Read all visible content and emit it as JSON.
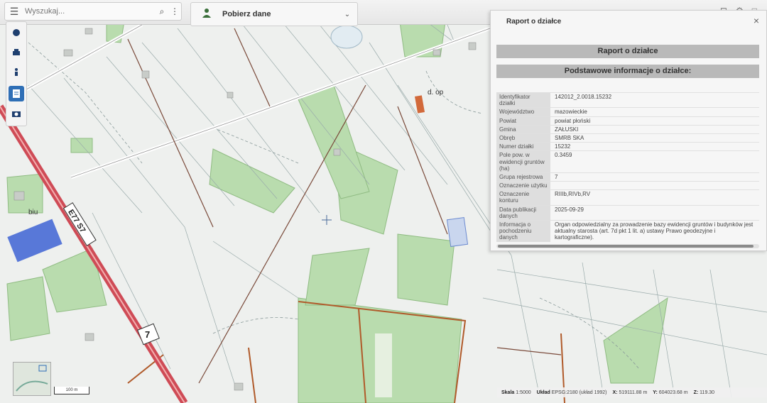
{
  "search": {
    "placeholder": "Wyszukaj..."
  },
  "download": {
    "label": "Pobierz dane"
  },
  "toolbar": {
    "items": [
      {
        "icon": "layers-icon"
      },
      {
        "icon": "print-icon"
      },
      {
        "icon": "street-view-icon"
      },
      {
        "icon": "report-icon"
      },
      {
        "icon": "camera-icon"
      }
    ]
  },
  "map_labels": {
    "road": "E77 S7",
    "route_number": "7",
    "building_label": "biu",
    "field_label": "d. op"
  },
  "panel": {
    "title": "Raport o działce",
    "header_report": "Raport o działce",
    "header_basic": "Podstawowe informacje o działce:",
    "rows": [
      {
        "key": "Identyfikator działki",
        "value": "142012_2.0018.15232"
      },
      {
        "key": "Województwo",
        "value": "mazowieckie"
      },
      {
        "key": "Powiat",
        "value": "powiat płoński"
      },
      {
        "key": "Gmina",
        "value": "ZAŁUSKI"
      },
      {
        "key": "Obręb",
        "value": "SMRB SKA"
      },
      {
        "key": "Numer działki",
        "value": "15232"
      },
      {
        "key": "Pole pow. w ewidencji gruntów (ha)",
        "value": "0.3459"
      },
      {
        "key": "Grupa rejestrowa",
        "value": "7"
      },
      {
        "key": "Oznaczenie użytku",
        "value": ""
      },
      {
        "key": "Oznaczenie konturu",
        "value": "RIIIb,RIVb,RV"
      },
      {
        "key": "Data publikacji danych",
        "value": "2025-09-29"
      },
      {
        "key": "Informacja o pochodzeniu danych",
        "value": "Organ odpowiedzialny za prowadzenie bazy ewidencji gruntów i budynków jest aktualny starosta (art. 7d pkt 1 lit. a) ustawy Prawo geodezyjne i kartograficzne)."
      }
    ]
  },
  "scale_bar": "100 m",
  "status": {
    "scale_label": "Skala",
    "scale_value": "1:5000",
    "crs_label": "Układ",
    "crs_value": "EPSG:2180 (układ 1992)",
    "x_label": "X:",
    "x_value": "519111.88 m",
    "y_label": "Y:",
    "y_value": "604023.68 m",
    "z_label": "Z:",
    "z_value": "119.30"
  },
  "colors": {
    "road": "#d94b55",
    "forest": "#b9dcae",
    "panel_header": "#b9b9b9",
    "accent": "#2f6fb6",
    "building": "#d2693a"
  }
}
